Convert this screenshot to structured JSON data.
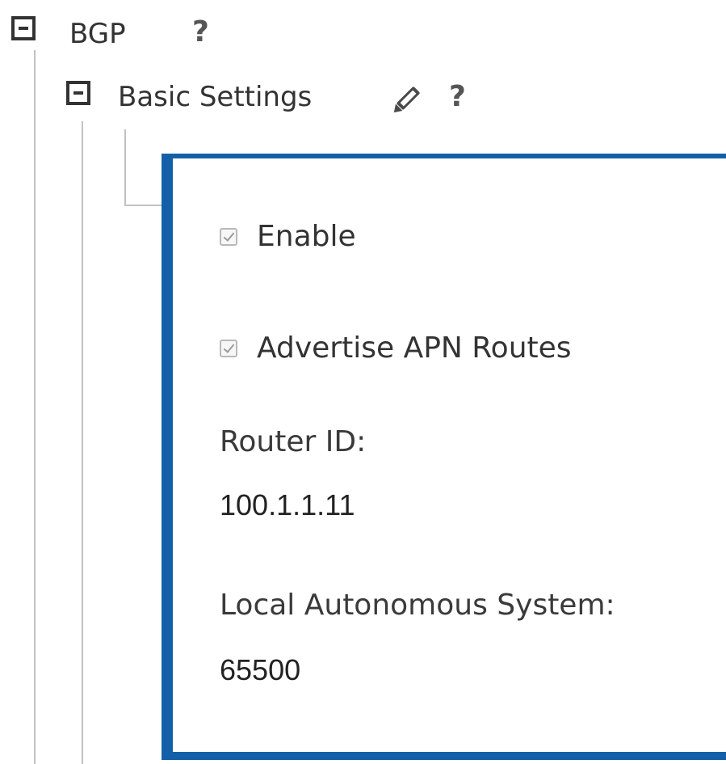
{
  "tree": {
    "root": {
      "label": "BGP",
      "toggle_icon": "minus-box-icon",
      "help_icon": "help-question-icon",
      "help_text": "?"
    },
    "child": {
      "label": "Basic Settings",
      "toggle_icon": "minus-box-icon",
      "edit_icon": "pencil-icon",
      "help_icon": "help-question-icon",
      "help_text": "?"
    }
  },
  "panel": {
    "accent_color": "#1460a8",
    "checkboxes": [
      {
        "label": "Enable",
        "checked": true,
        "disabled": true
      },
      {
        "label": "Advertise APN Routes",
        "checked": true,
        "disabled": true
      }
    ],
    "fields": [
      {
        "label": "Router ID:",
        "value": "100.1.1.11"
      },
      {
        "label": "Local Autonomous System:",
        "value": "65500"
      }
    ]
  }
}
